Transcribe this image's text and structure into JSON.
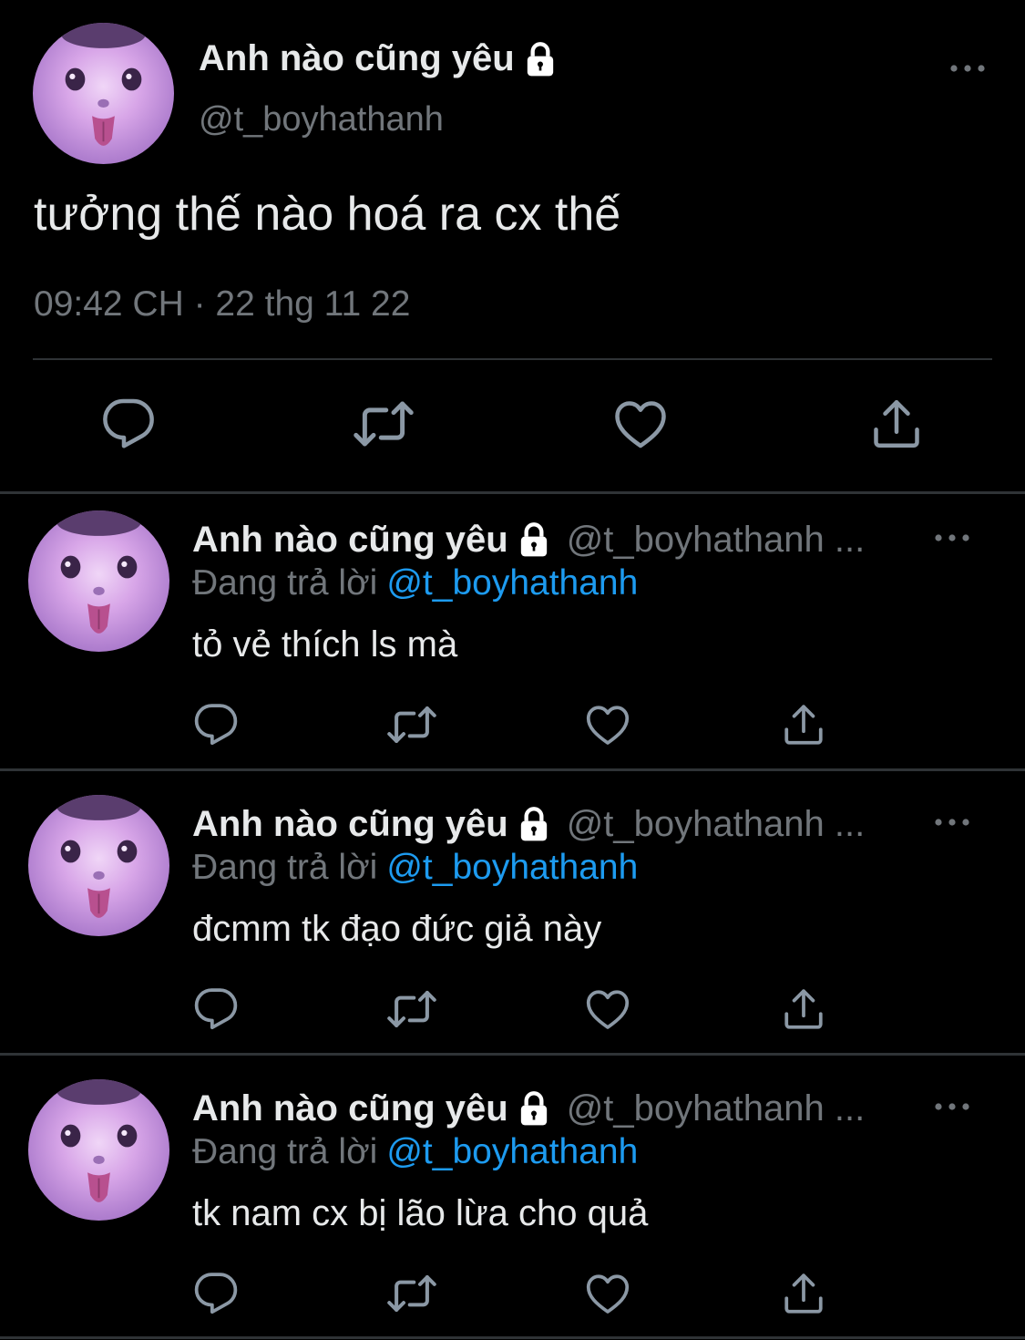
{
  "main_tweet": {
    "author_name": "Anh nào cũng yêu",
    "author_handle": "@t_boyhathanh",
    "text": "tưởng thế nào hoá ra cx thế",
    "timestamp": "09:42 CH · 22 thg 11 22",
    "locked": true
  },
  "actions": [
    "reply-icon",
    "retweet-icon",
    "like-icon",
    "share-icon"
  ],
  "replies": [
    {
      "author_name": "Anh nào cũng yêu",
      "author_handle": "@t_boyhathanh ...",
      "replying_label": "Đang trả lời",
      "replying_to": "@t_boyhathanh",
      "text": "tỏ vẻ thích ls mà"
    },
    {
      "author_name": "Anh nào cũng yêu",
      "author_handle": "@t_boyhathanh ...",
      "replying_label": "Đang trả lời",
      "replying_to": "@t_boyhathanh",
      "text": "đcmm tk đạo đức giả này"
    },
    {
      "author_name": "Anh nào cũng yêu",
      "author_handle": "@t_boyhathanh ...",
      "replying_label": "Đang trả lời",
      "replying_to": "@t_boyhathanh",
      "text": "tk nam cx bị lão lừa cho quả"
    }
  ],
  "colors": {
    "background": "#000000",
    "text_primary": "#e7e9ea",
    "text_secondary": "#71767b",
    "link": "#1d9bf0",
    "divider": "#2f3336"
  }
}
